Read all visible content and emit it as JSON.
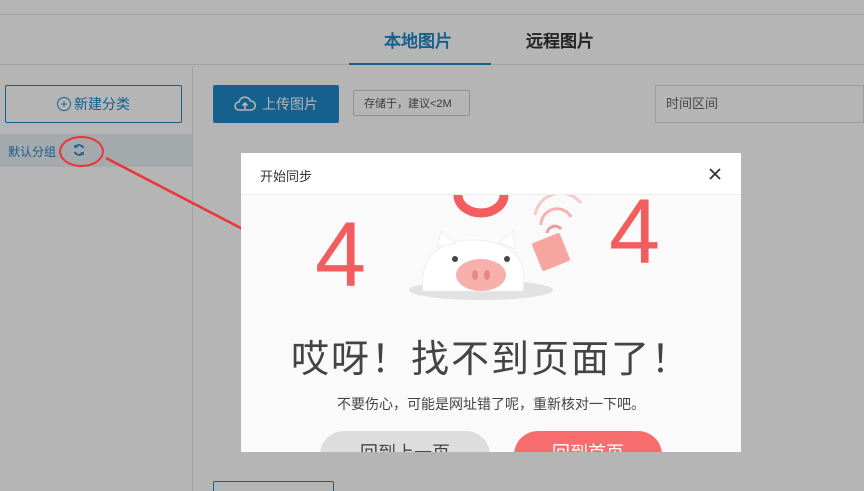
{
  "tabs": {
    "local": "本地图片",
    "remote": "远程图片"
  },
  "sidebar": {
    "new_category": "新建分类",
    "default_group": "默认分组"
  },
  "toolbar": {
    "upload": "上传图片",
    "hint": "存储于，建议<2M",
    "date_placeholder": "时间区间"
  },
  "modal": {
    "title": "开始同步",
    "digit_left": "4",
    "digit_right": "4",
    "error_title": "哎呀！找不到页面了！",
    "error_subtitle": "不要伤心，可能是网址错了呢，重新核对一下吧。",
    "back_button": "回到上一页",
    "home_button": "回到首页"
  },
  "colors": {
    "accent": "#1e88c7",
    "error_red": "#f25e5f",
    "annotation_red": "#e8363a"
  }
}
